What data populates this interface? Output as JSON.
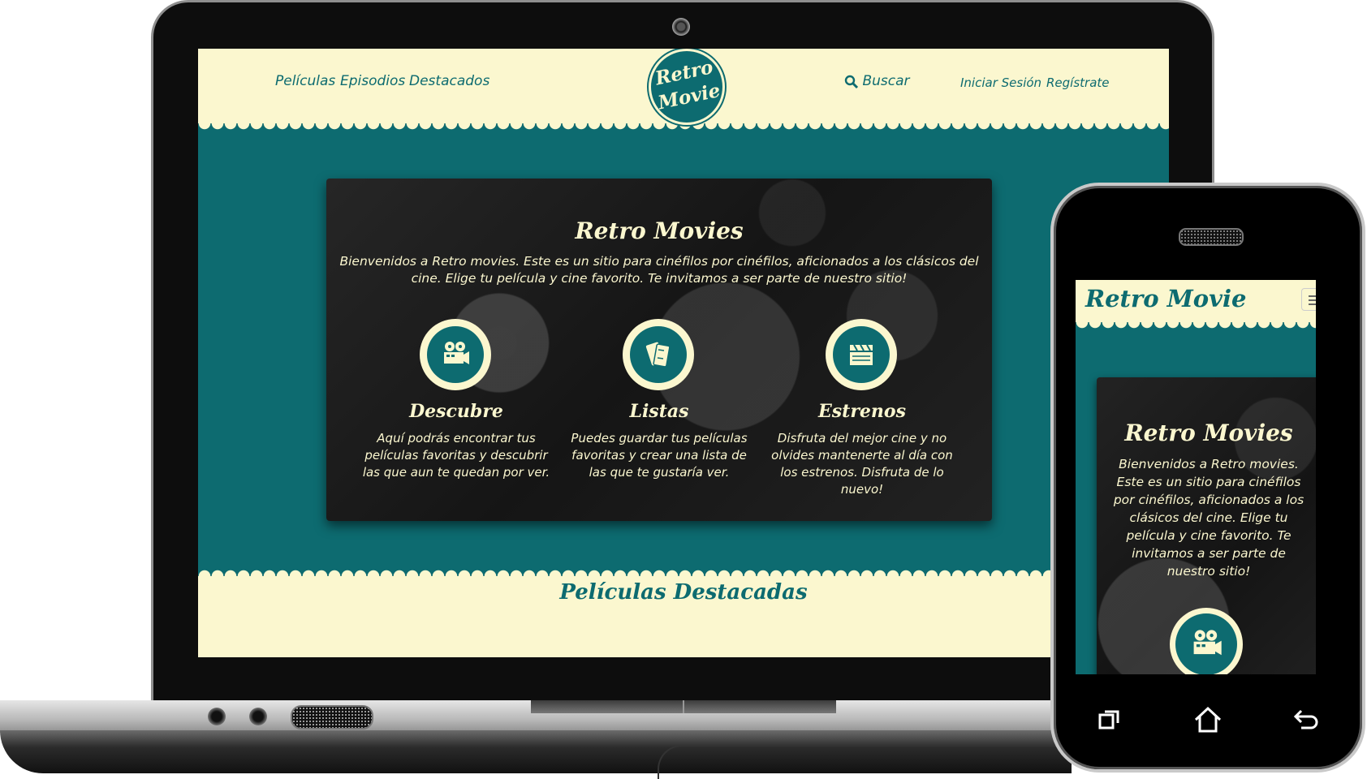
{
  "site": {
    "nav_left": [
      "Películas",
      "Episodios",
      "Destacados"
    ],
    "logo_line1": "Retro",
    "logo_line2": "Movie",
    "search_label": "Buscar",
    "login_label": "Iniciar Sesión",
    "register_label": "Regístrate",
    "hero": {
      "title": "Retro Movies",
      "text": "Bienvenidos a Retro movies. Este es un sitio para cinéfilos por cinéfilos, aficionados a los clásicos del cine. Elige tu película y cine favorito. Te invitamos a ser parte de nuestro sitio!"
    },
    "features": [
      {
        "title": "Descubre",
        "text": "Aquí podrás encontrar tus películas favoritas y descubrir las que aun te quedan por ver.",
        "icon": "movie-camera-icon"
      },
      {
        "title": "Listas",
        "text": "Puedes guardar tus películas favoritas y crear una lista de las que te gustaría ver.",
        "icon": "tickets-icon"
      },
      {
        "title": "Estrenos",
        "text": "Disfruta del mejor cine y no olvides mantenerte al día con los estrenos. Disfruta de lo nuevo!",
        "icon": "clapperboard-icon"
      }
    ],
    "featured_title": "Películas Destacadas"
  },
  "mobile": {
    "logo": "Retro Movie",
    "hero_title": "Retro Movies",
    "hero_text": "Bienvenidos a Retro movies. Este es un sitio para cinéfilos por cinéfilos, aficionados a los clásicos del cine. Elige tu película y cine favorito. Te invitamos a ser parte de nuestro sitio!"
  },
  "colors": {
    "teal": "#0d6b70",
    "cream": "#fbf7cf",
    "dark": "#141414"
  }
}
